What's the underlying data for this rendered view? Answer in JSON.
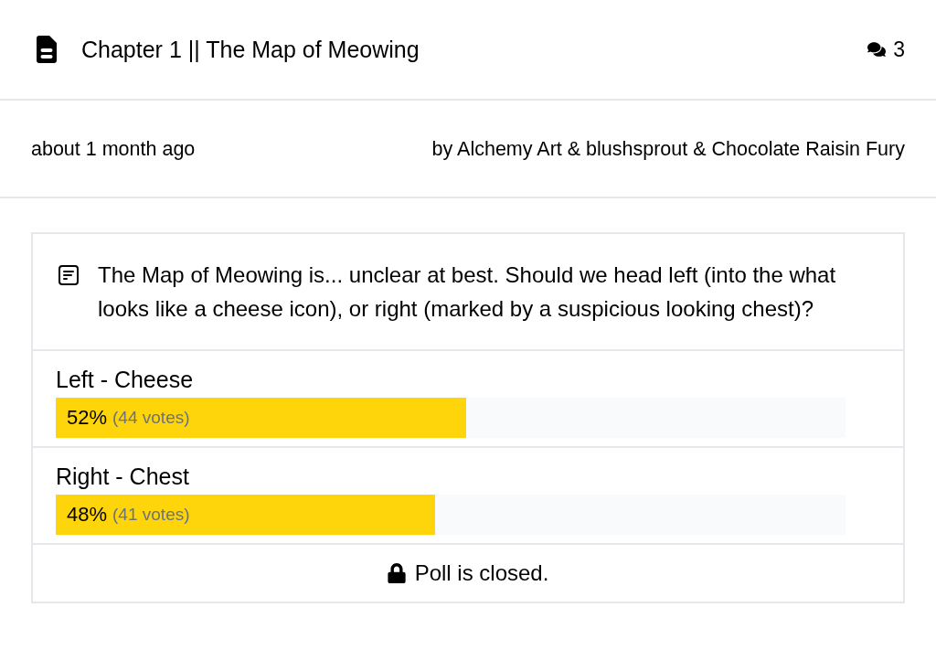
{
  "header": {
    "title": "Chapter 1 || The Map of Meowing",
    "comment_count": "3"
  },
  "meta": {
    "posted": "about 1 month ago",
    "authors": "by Alchemy Art & blushsprout & Chocolate Raisin Fury"
  },
  "poll": {
    "question": "The Map of Meowing is... unclear at best. Should we head left (into the what looks like a cheese icon), or right (marked by a suspicious looking chest)?",
    "options": [
      {
        "label": "Left - Cheese",
        "percent": "52%",
        "votes": "(44 votes)",
        "level": 0.52
      },
      {
        "label": "Right - Chest",
        "percent": "48%",
        "votes": "(41 votes)",
        "level": 0.48
      }
    ],
    "status": "Poll is closed."
  }
}
